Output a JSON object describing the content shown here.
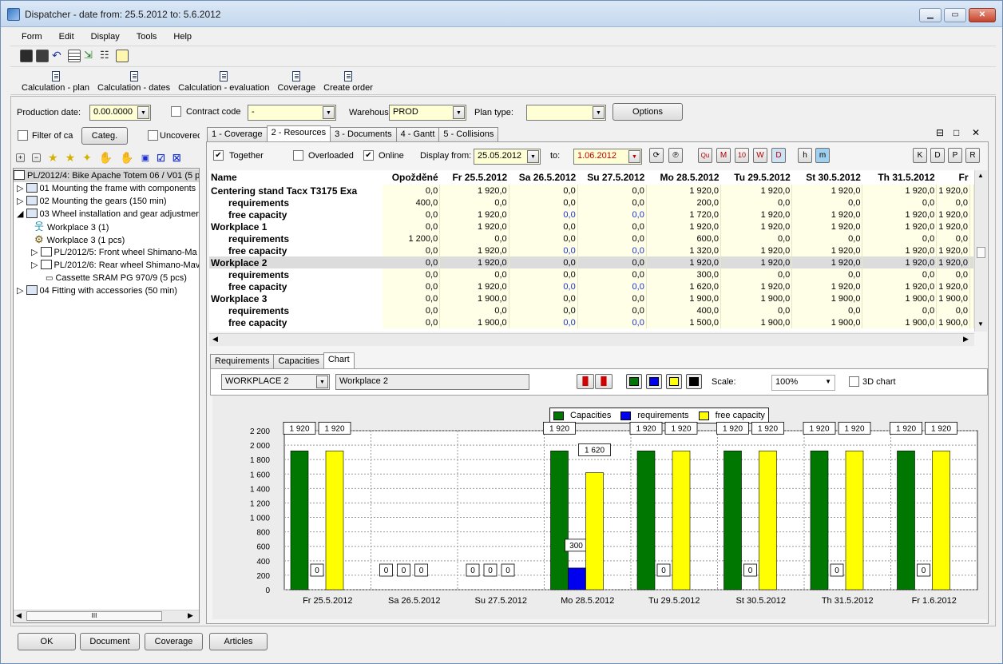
{
  "window": {
    "title": "Dispatcher - date from: 25.5.2012 to: 5.6.2012"
  },
  "menu": [
    "Form",
    "Edit",
    "Display",
    "Tools",
    "Help"
  ],
  "toolbar2": [
    "Calculation - plan",
    "Calculation - dates",
    "Calculation - evaluation",
    "Coverage",
    "Create order"
  ],
  "filters": {
    "production_date_label": "Production date:",
    "production_date_value": "0.00.0000",
    "contract_code_label": "Contract code",
    "contract_code_value": "-",
    "warehouse_label": "Warehous",
    "warehouse_value": "PROD",
    "plan_type_label": "Plan type:",
    "plan_type_value": "",
    "options_button": "Options",
    "filter_label": "Filter of ca",
    "categ_button": "Categ.",
    "uncovered_label": "Uncovered"
  },
  "tree": {
    "root": "PL/2012/4: Bike Apache Totem 06 / V01 (5 p",
    "items": [
      "01 Mounting the frame with components",
      "02 Mounting the gears (150 min)",
      "03 Wheel installation and gear adjustmer",
      "Workplace 3 (1)",
      "Workplace 3 (1 pcs)",
      "PL/2012/5: Front wheel Shimano-Ma",
      "PL/2012/6: Rear wheel Shimano-Mav",
      "Cassette SRAM PG 970/9 (5 pcs)",
      "04 Fitting with accessories (50 min)"
    ],
    "scroll_label": "III"
  },
  "main_tabs": [
    "1 - Coverage",
    "2 - Resources",
    "3 - Documents",
    "4 - Gantt",
    "5 - Collisions"
  ],
  "resources": {
    "together_label": "Together",
    "overloaded_label": "Overloaded",
    "online_label": "Online",
    "display_from_label": "Display from:",
    "display_from_value": "25.05.2012",
    "to_label": "to:",
    "to_value": "1.06.2012",
    "period_buttons": [
      "Qu",
      "M",
      "10",
      "W",
      "D"
    ],
    "unit_buttons": [
      "h",
      "m"
    ],
    "kdpr_buttons": [
      "K",
      "D",
      "P",
      "R"
    ],
    "window_controls": [
      "⊟",
      "□",
      "✕"
    ]
  },
  "grid": {
    "headers": [
      "Name",
      "Opožděné",
      "Fr 25.5.2012",
      "Sa 26.5.2012",
      "Su 27.5.2012",
      "Mo 28.5.2012",
      "Tu 29.5.2012",
      "St 30.5.2012",
      "Th 31.5.2012",
      "Fr"
    ],
    "rows": [
      {
        "name": "Centering stand Tacx T3175 Exa",
        "level": 1,
        "values": [
          "0,0",
          "1 920,0",
          "0,0",
          "0,0",
          "1 920,0",
          "1 920,0",
          "1 920,0",
          "1 920,0",
          "1 920,0"
        ]
      },
      {
        "name": "requirements",
        "level": 2,
        "values": [
          "400,0",
          "0,0",
          "0,0",
          "0,0",
          "200,0",
          "0,0",
          "0,0",
          "0,0",
          "0,0"
        ]
      },
      {
        "name": "free capacity",
        "level": 2,
        "blue": true,
        "values": [
          "0,0",
          "1 920,0",
          "0,0",
          "0,0",
          "1 720,0",
          "1 920,0",
          "1 920,0",
          "1 920,0",
          "1 920,0"
        ]
      },
      {
        "name": "Workplace 1",
        "level": 1,
        "values": [
          "0,0",
          "1 920,0",
          "0,0",
          "0,0",
          "1 920,0",
          "1 920,0",
          "1 920,0",
          "1 920,0",
          "1 920,0"
        ]
      },
      {
        "name": "requirements",
        "level": 2,
        "values": [
          "1 200,0",
          "0,0",
          "0,0",
          "0,0",
          "600,0",
          "0,0",
          "0,0",
          "0,0",
          "0,0"
        ]
      },
      {
        "name": "free capacity",
        "level": 2,
        "blue": true,
        "values": [
          "0,0",
          "1 920,0",
          "0,0",
          "0,0",
          "1 320,0",
          "1 920,0",
          "1 920,0",
          "1 920,0",
          "1 920,0"
        ]
      },
      {
        "name": "Workplace 2",
        "level": 1,
        "selected": true,
        "values": [
          "0,0",
          "1 920,0",
          "0,0",
          "0,0",
          "1 920,0",
          "1 920,0",
          "1 920,0",
          "1 920,0",
          "1 920,0"
        ]
      },
      {
        "name": "requirements",
        "level": 2,
        "values": [
          "0,0",
          "0,0",
          "0,0",
          "0,0",
          "300,0",
          "0,0",
          "0,0",
          "0,0",
          "0,0"
        ]
      },
      {
        "name": "free capacity",
        "level": 2,
        "blue": true,
        "values": [
          "0,0",
          "1 920,0",
          "0,0",
          "0,0",
          "1 620,0",
          "1 920,0",
          "1 920,0",
          "1 920,0",
          "1 920,0"
        ]
      },
      {
        "name": "Workplace 3",
        "level": 1,
        "values": [
          "0,0",
          "1 900,0",
          "0,0",
          "0,0",
          "1 900,0",
          "1 900,0",
          "1 900,0",
          "1 900,0",
          "1 900,0"
        ]
      },
      {
        "name": "requirements",
        "level": 2,
        "values": [
          "0,0",
          "0,0",
          "0,0",
          "0,0",
          "400,0",
          "0,0",
          "0,0",
          "0,0",
          "0,0"
        ]
      },
      {
        "name": "free capacity",
        "level": 2,
        "blue": true,
        "values": [
          "0,0",
          "1 900,0",
          "0,0",
          "0,0",
          "1 500,0",
          "1 900,0",
          "1 900,0",
          "1 900,0",
          "1 900,0"
        ]
      }
    ]
  },
  "bottom_tabs": [
    "Requirements",
    "Capacities",
    "Chart"
  ],
  "chart_controls": {
    "workplace_code": "WORKPLACE 2",
    "workplace_name": "Workplace 2",
    "scale_label": "Scale:",
    "scale_value": "100%",
    "chart3d_label": "3D chart"
  },
  "colors": {
    "capacities": "#007700",
    "requirements": "#0000ee",
    "free_capacity": "#ffff00"
  },
  "chart_data": {
    "type": "bar",
    "categories": [
      "Fr 25.5.2012",
      "Sa 26.5.2012",
      "Su 27.5.2012",
      "Mo 28.5.2012",
      "Tu 29.5.2012",
      "St 30.5.2012",
      "Th 31.5.2012",
      "Fr 1.6.2012"
    ],
    "series": [
      {
        "name": "Capacities",
        "values": [
          1920,
          0,
          0,
          1920,
          1920,
          1920,
          1920,
          1920
        ]
      },
      {
        "name": "requirements",
        "values": [
          0,
          0,
          0,
          300,
          0,
          0,
          0,
          0
        ]
      },
      {
        "name": "free capacity",
        "values": [
          1920,
          0,
          0,
          1620,
          1920,
          1920,
          1920,
          1920
        ]
      }
    ],
    "ylim": [
      0,
      2200
    ],
    "yticks": [
      "0",
      "200",
      "400",
      "600",
      "800",
      "1 000",
      "1 200",
      "1 400",
      "1 600",
      "1 800",
      "2 000",
      "2 200"
    ],
    "data_labels": [
      [
        "1 920",
        "0",
        "1 920"
      ],
      [
        "0",
        "0",
        "0"
      ],
      [
        "0",
        "0",
        "0"
      ],
      [
        "1 920",
        "300",
        "1 620"
      ],
      [
        "1 920",
        "0",
        "1 920"
      ],
      [
        "1 920",
        "0",
        "1 920"
      ],
      [
        "1 920",
        "0",
        "1 920"
      ],
      [
        "1 920",
        "0",
        "1 920"
      ]
    ],
    "grid": true,
    "legend": "top-center"
  },
  "bottom_buttons": [
    "OK",
    "Document",
    "Coverage",
    "Articles"
  ]
}
